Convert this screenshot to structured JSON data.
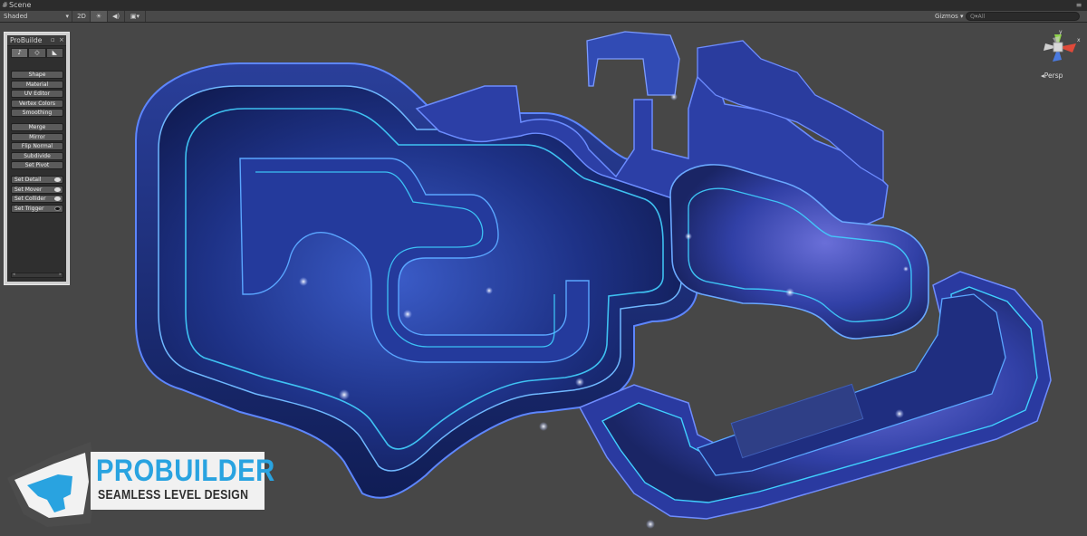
{
  "window": {
    "tab_label": "Scene",
    "tab_icon": "scene-icon"
  },
  "toolbar": {
    "shading_mode": "Shaded",
    "mode_2d_label": "2D",
    "lighting_icon": "sun-icon",
    "audio_icon": "speaker-icon",
    "effects_icon": "image-icon",
    "gizmos_label": "Gizmos",
    "search_placeholder": "Q▾All"
  },
  "probuilder_panel": {
    "title": "ProBuilde",
    "modes": [
      "object-mode-icon",
      "vertex-mode-icon",
      "face-mode-icon"
    ],
    "buttons": [
      "Shape",
      "Material",
      "UV Editor",
      "Vertex Colors",
      "Smoothing"
    ],
    "geometry_buttons": [
      "Merge",
      "Mirror",
      "Flip Normal",
      "Subdivide",
      "Set Pivot"
    ],
    "entity_buttons": [
      "Set Detail",
      "Set Mover",
      "Set Collider",
      "Set Trigger"
    ]
  },
  "gizmo": {
    "projection_label": "Persp",
    "axis_colors": {
      "x": "#e04a3a",
      "y": "#8ed24a",
      "z": "#4a7ae0"
    }
  },
  "logo": {
    "title": "PROBUILDER",
    "subtitle": "SEAMLESS LEVEL DESIGN",
    "accent": "#29a3e0"
  }
}
